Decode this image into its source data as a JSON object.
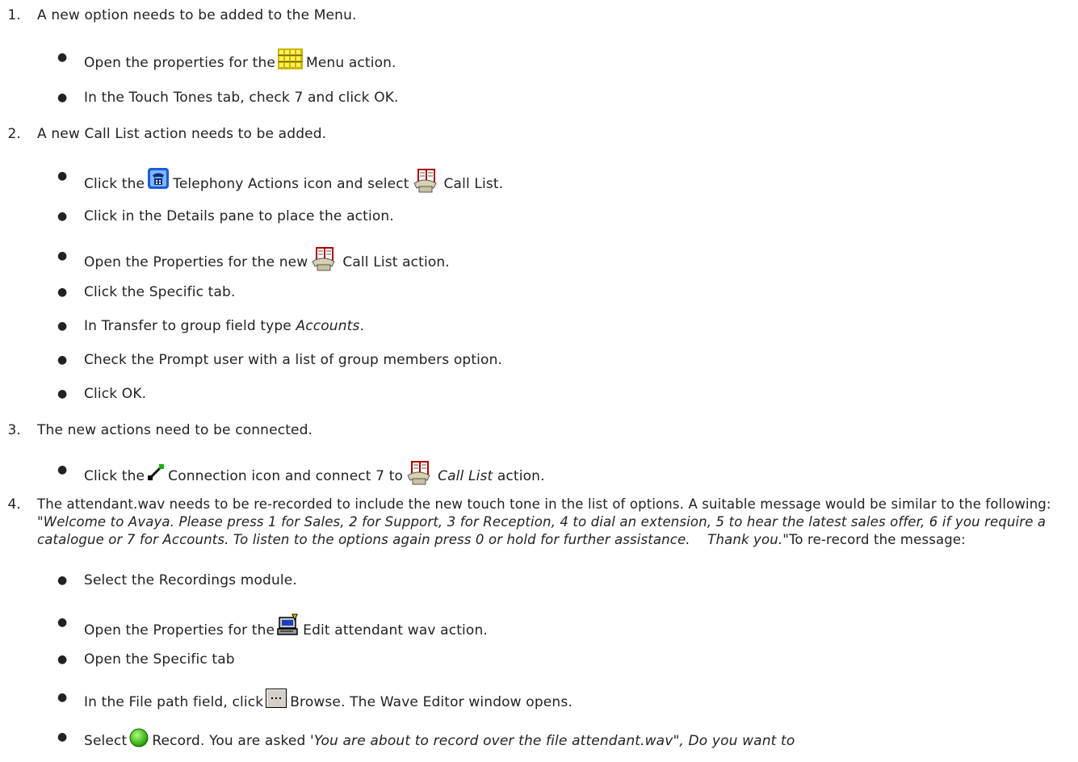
{
  "steps": [
    {
      "num": "1.",
      "text": "A new option needs to be added to the Menu."
    },
    {
      "num": "2.",
      "text": "A new Call List action needs to be added."
    },
    {
      "num": "3.",
      "text": "The new actions need to be connected."
    },
    {
      "num": "4."
    }
  ],
  "step1": {
    "b1_pre": "Open the properties for the",
    "b1_post": "Menu action.",
    "b2": "In the Touch Tones tab, check 7 and click OK."
  },
  "step2": {
    "b1_pre": "Click the",
    "b1_mid": "Telephony Actions icon and select",
    "b1_post": "Call List.",
    "b2": "Click in the Details pane to place the action.",
    "b3_pre": "Open the Properties for the new",
    "b3_post": "Call List action.",
    "b4": "Click the Specific tab.",
    "b5_pre": "In Transfer to group field type",
    "b5_em": "Accounts",
    "b5_post": ".",
    "b6": "Check the Prompt user with a list of group members option.",
    "b7": "Click OK."
  },
  "step3": {
    "b1_pre": "Click the",
    "b1_mid": "Connection icon and connect 7 to",
    "b1_em": "Call List",
    "b1_post": "action."
  },
  "step4": {
    "intro": "The attendant.wav needs to be re-recorded to include the new touch tone in the list of options. A suitable message would be similar to the following:",
    "quote": "\"Welcome to Avaya. Please press 1 for Sales, 2 for Support, 3 for Reception, 4 to dial an extension, 5 to hear the latest sales offer, 6 if you require a catalogue or 7 for Accounts. To listen to the options again press 0 or hold for further assistance.    Thank you.",
    "after": "\"To re-record the message:",
    "b1": "Select the Recordings module.",
    "b2_pre": "Open the Properties for the",
    "b2_post": "Edit attendant wav action.",
    "b3": "Open the Specific tab",
    "b4_pre": "In the File path field,  click",
    "b4_post": "Browse. The Wave Editor window opens.",
    "b5_pre": "Select",
    "b5_mid": "Record. You are asked '",
    "b5_em": "You are about to record over the file attendant.wav\", Do you want to"
  },
  "icons": {
    "menu": "menu-grid-icon",
    "telephony": "telephony-actions-icon",
    "call_list": "call-list-icon",
    "connection": "connection-icon",
    "edit_wav": "edit-wav-icon",
    "browse": "browse-button-icon",
    "record": "record-icon"
  },
  "colors": {
    "text": "#222222",
    "menu_icon": "#d8c600",
    "telephony_icon": "#1a5ed8",
    "record_icon": "#33cc00"
  }
}
